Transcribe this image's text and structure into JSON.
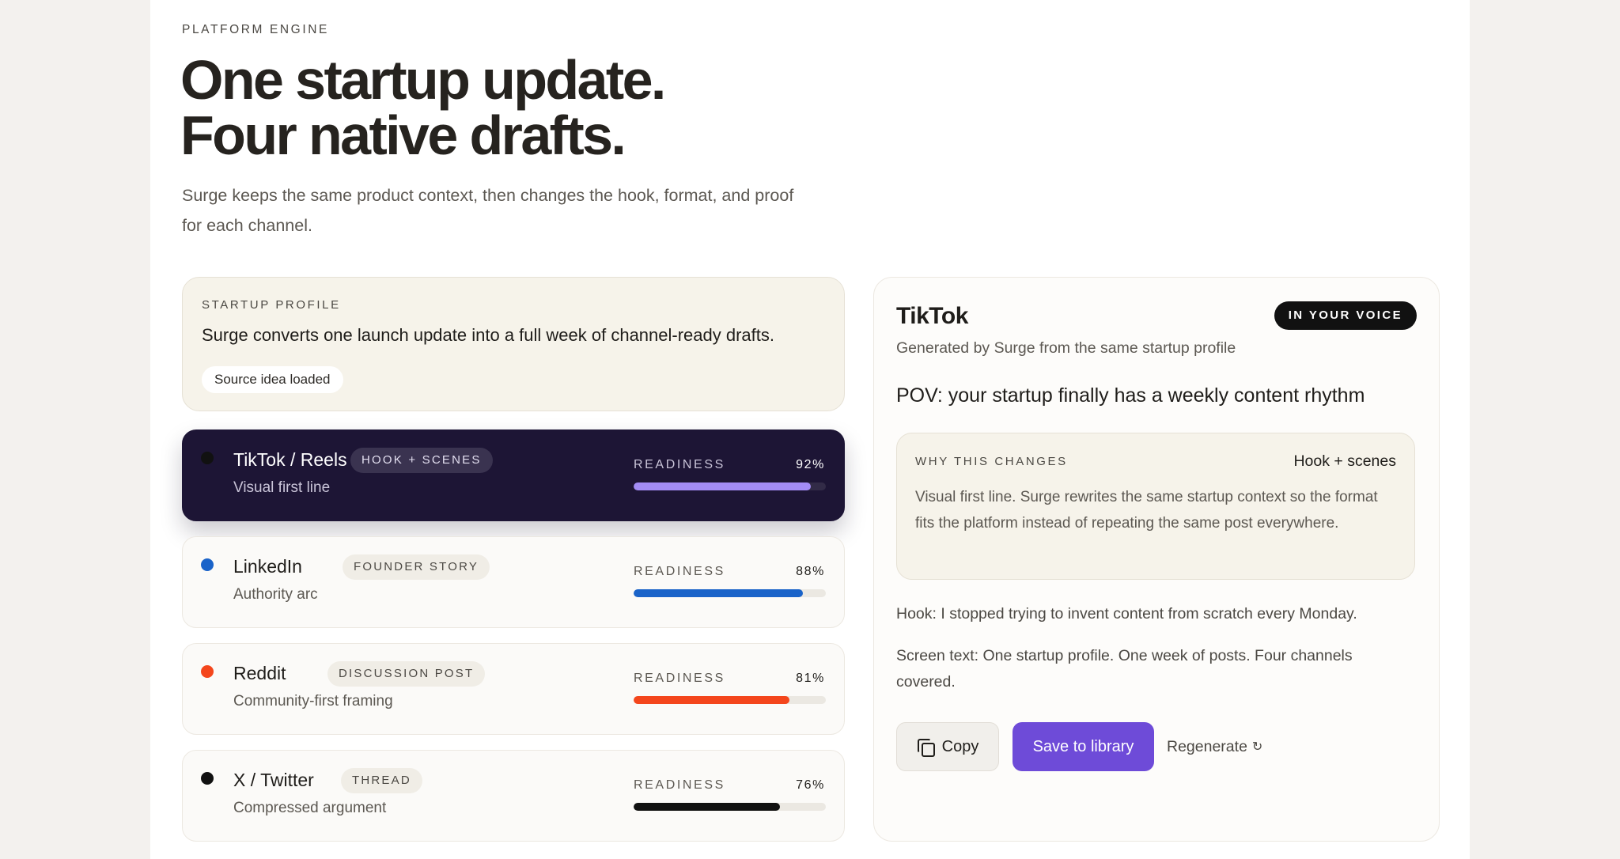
{
  "header": {
    "eyebrow": "PLATFORM ENGINE",
    "headline_line1": "One startup update.",
    "headline_line2": "Four native drafts.",
    "subtitle": "Surge keeps the same product context, then changes the hook, format, and proof for each channel."
  },
  "profile": {
    "label": "STARTUP PROFILE",
    "text": "Surge converts one launch update into a full week of channel-ready drafts.",
    "source_pill": "Source idea loaded"
  },
  "channels": [
    {
      "name": "TikTok / Reels",
      "badge": "HOOK + SCENES",
      "subtitle": "Visual first line",
      "readiness_label": "READINESS",
      "readiness_text": "92%",
      "readiness": 0.92,
      "color": "#a38cf5",
      "dot": "#111111",
      "active": true
    },
    {
      "name": "LinkedIn",
      "badge": "FOUNDER STORY",
      "subtitle": "Authority arc",
      "readiness_label": "READINESS",
      "readiness_text": "88%",
      "readiness": 0.88,
      "color": "#1a63c9",
      "dot": "#1a63c9",
      "active": false
    },
    {
      "name": "Reddit",
      "badge": "DISCUSSION POST",
      "subtitle": "Community-first framing",
      "readiness_label": "READINESS",
      "readiness_text": "81%",
      "readiness": 0.81,
      "color": "#f4461c",
      "dot": "#f4461c",
      "active": false
    },
    {
      "name": "X / Twitter",
      "badge": "THREAD",
      "subtitle": "Compressed argument",
      "readiness_label": "READINESS",
      "readiness_text": "76%",
      "readiness": 0.76,
      "color": "#111111",
      "dot": "#111111",
      "active": false
    }
  ],
  "detail": {
    "title": "TikTok",
    "voice_badge": "IN YOUR VOICE",
    "subtitle": "Generated by Surge from the same startup profile",
    "pov": "POV: your startup finally has a weekly content rhythm",
    "why_label": "WHY THIS CHANGES",
    "why_right": "Hook + scenes",
    "why_text": "Visual first line. Surge rewrites the same startup context so the format fits the platform instead of repeating the same post everywhere.",
    "hook": "Hook: I stopped trying to invent content from scratch every Monday.",
    "screen_text": "Screen text: One startup profile. One week of posts. Four channels covered.",
    "copy_label": "Copy",
    "save_label": "Save to library",
    "regenerate_label": "Regenerate",
    "regenerate_icon": "↻"
  },
  "colors": {
    "accent": "#6e4bd8",
    "active_card": "#1d1535",
    "page_bg": "#f3f1ee"
  }
}
